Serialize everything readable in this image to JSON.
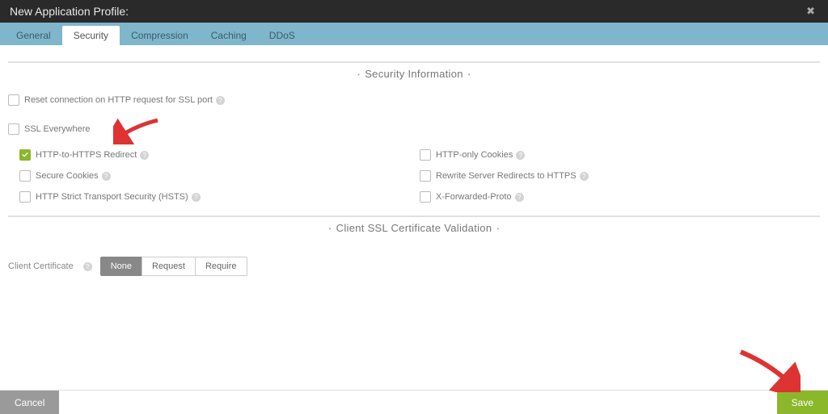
{
  "header": {
    "title": "New Application Profile:"
  },
  "tabs": [
    {
      "label": "General",
      "active": false
    },
    {
      "label": "Security",
      "active": true
    },
    {
      "label": "Compression",
      "active": false
    },
    {
      "label": "Caching",
      "active": false
    },
    {
      "label": "DDoS",
      "active": false
    }
  ],
  "sections": {
    "security": {
      "title": "Security Information",
      "reset_connection": {
        "label": "Reset connection on HTTP request for SSL port",
        "checked": false
      },
      "ssl_everywhere": {
        "label": "SSL Everywhere",
        "checked": false
      },
      "http_https_redirect": {
        "label": "HTTP-to-HTTPS Redirect",
        "checked": true
      },
      "secure_cookies": {
        "label": "Secure Cookies",
        "checked": false
      },
      "hsts": {
        "label": "HTTP Strict Transport Security (HSTS)",
        "checked": false
      },
      "http_only_cookies": {
        "label": "HTTP-only Cookies",
        "checked": false
      },
      "rewrite_redirects": {
        "label": "Rewrite Server Redirects to HTTPS",
        "checked": false
      },
      "x_forwarded_proto": {
        "label": "X-Forwarded-Proto",
        "checked": false
      }
    },
    "client_ssl": {
      "title": "Client SSL Certificate Validation",
      "field_label": "Client Certificate",
      "options": [
        "None",
        "Request",
        "Require"
      ],
      "selected": "None"
    }
  },
  "footer": {
    "cancel": "Cancel",
    "save": "Save"
  }
}
